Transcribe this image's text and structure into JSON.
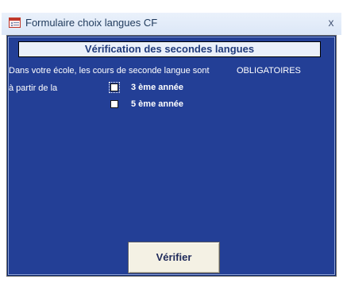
{
  "window": {
    "title": "Formulaire choix langues CF",
    "close_glyph": "x",
    "icon": "form-icon"
  },
  "form": {
    "header": "Vérification des secondes langues",
    "intro_text": "Dans votre école, les cours de seconde langue sont",
    "status_value": "OBLIGATOIRES",
    "from_label": "à partir de la",
    "options": [
      {
        "label": "3 ème année",
        "checked": false
      },
      {
        "label": "5 ème année",
        "checked": false
      }
    ],
    "verify_button": "Vérifier"
  },
  "colors": {
    "form_background": "#233f96",
    "header_background": "#eaf0fa",
    "button_background": "#f4f1e4"
  }
}
